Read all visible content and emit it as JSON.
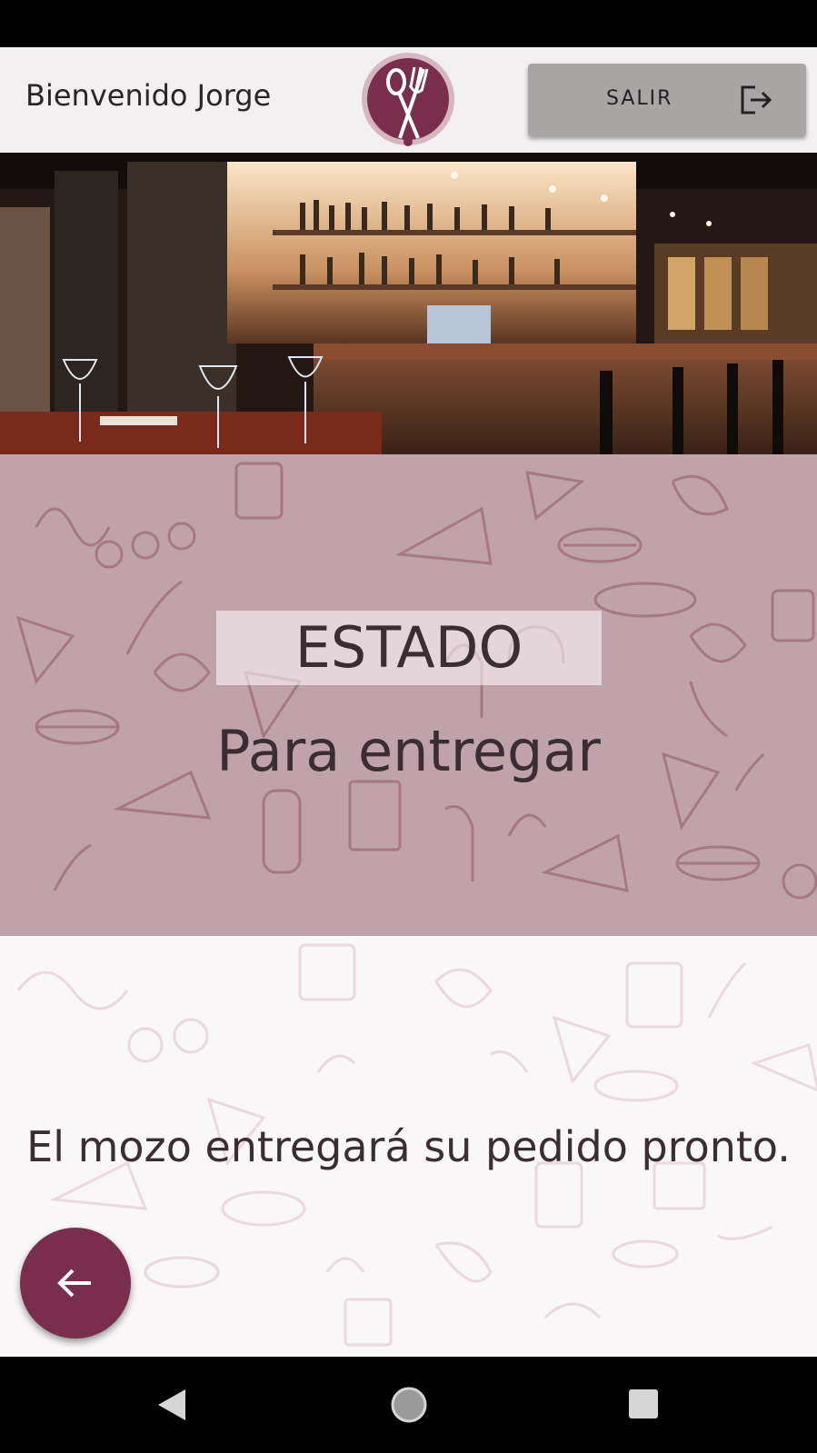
{
  "header": {
    "welcome_text": "Bienvenido Jorge",
    "logo_icon": "spoon-fork-logo-icon",
    "exit_label": "SALIR",
    "exit_icon": "logout-icon"
  },
  "banner": {
    "image": "restaurant-bar-photo"
  },
  "status": {
    "label": "ESTADO",
    "value": "Para entregar"
  },
  "message": {
    "text": "El mozo entregará su pedido pronto."
  },
  "fab": {
    "icon": "arrow-left-icon"
  },
  "colors": {
    "accent": "#7a2e4e",
    "state_panel": "#c0a2aa",
    "exit_button": "#a9a5a5"
  }
}
